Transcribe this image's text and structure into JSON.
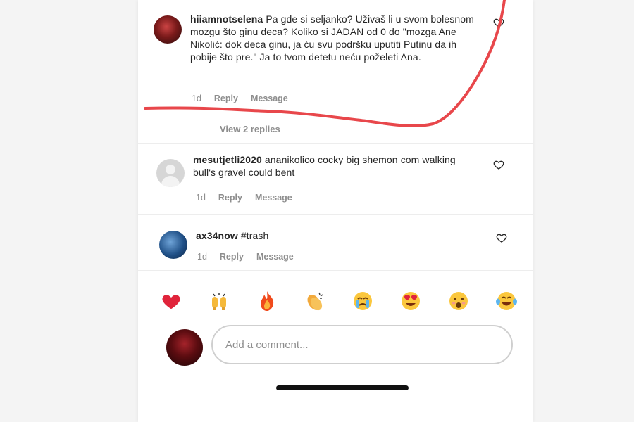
{
  "comments": [
    {
      "username": "hiiamnotselena",
      "text": "Pa gde si seljanko? Uživaš li u svom bolesnom mozgu što ginu deca? Koliko si JADAN od 0 do \"mozga Ane Nikolić: dok deca ginu, ja ću svu podršku uputiti Putinu da ih pobije što pre.\" Ja to tvom detetu neću poželeti Ana.",
      "time": "1d",
      "reply": "Reply",
      "message": "Message",
      "view_replies": "View 2 replies"
    },
    {
      "username": "mesutjetli2020",
      "text": "ananikolico cocky big shemon com walking bull's gravel could bent",
      "time": "1d",
      "reply": "Reply",
      "message": "Message"
    },
    {
      "username": "ax34now",
      "text": "#trash",
      "time": "1d",
      "reply": "Reply",
      "message": "Message"
    }
  ],
  "emoji_bar": [
    {
      "icon": "red-heart-icon",
      "glyph": "❤️"
    },
    {
      "icon": "raising-hands-icon",
      "glyph": "🙌"
    },
    {
      "icon": "fire-icon",
      "glyph": "🔥"
    },
    {
      "icon": "clapping-hands-icon",
      "glyph": "👏"
    },
    {
      "icon": "crying-face-icon",
      "glyph": "😢"
    },
    {
      "icon": "heart-eyes-icon",
      "glyph": "😍"
    },
    {
      "icon": "astonished-face-icon",
      "glyph": "😮"
    },
    {
      "icon": "tears-of-joy-icon",
      "glyph": "😂"
    }
  ],
  "comment_input": {
    "placeholder": "Add a comment..."
  },
  "colors": {
    "annotation": "#e8474b",
    "text": "#262626",
    "muted": "#8e8e8e"
  }
}
